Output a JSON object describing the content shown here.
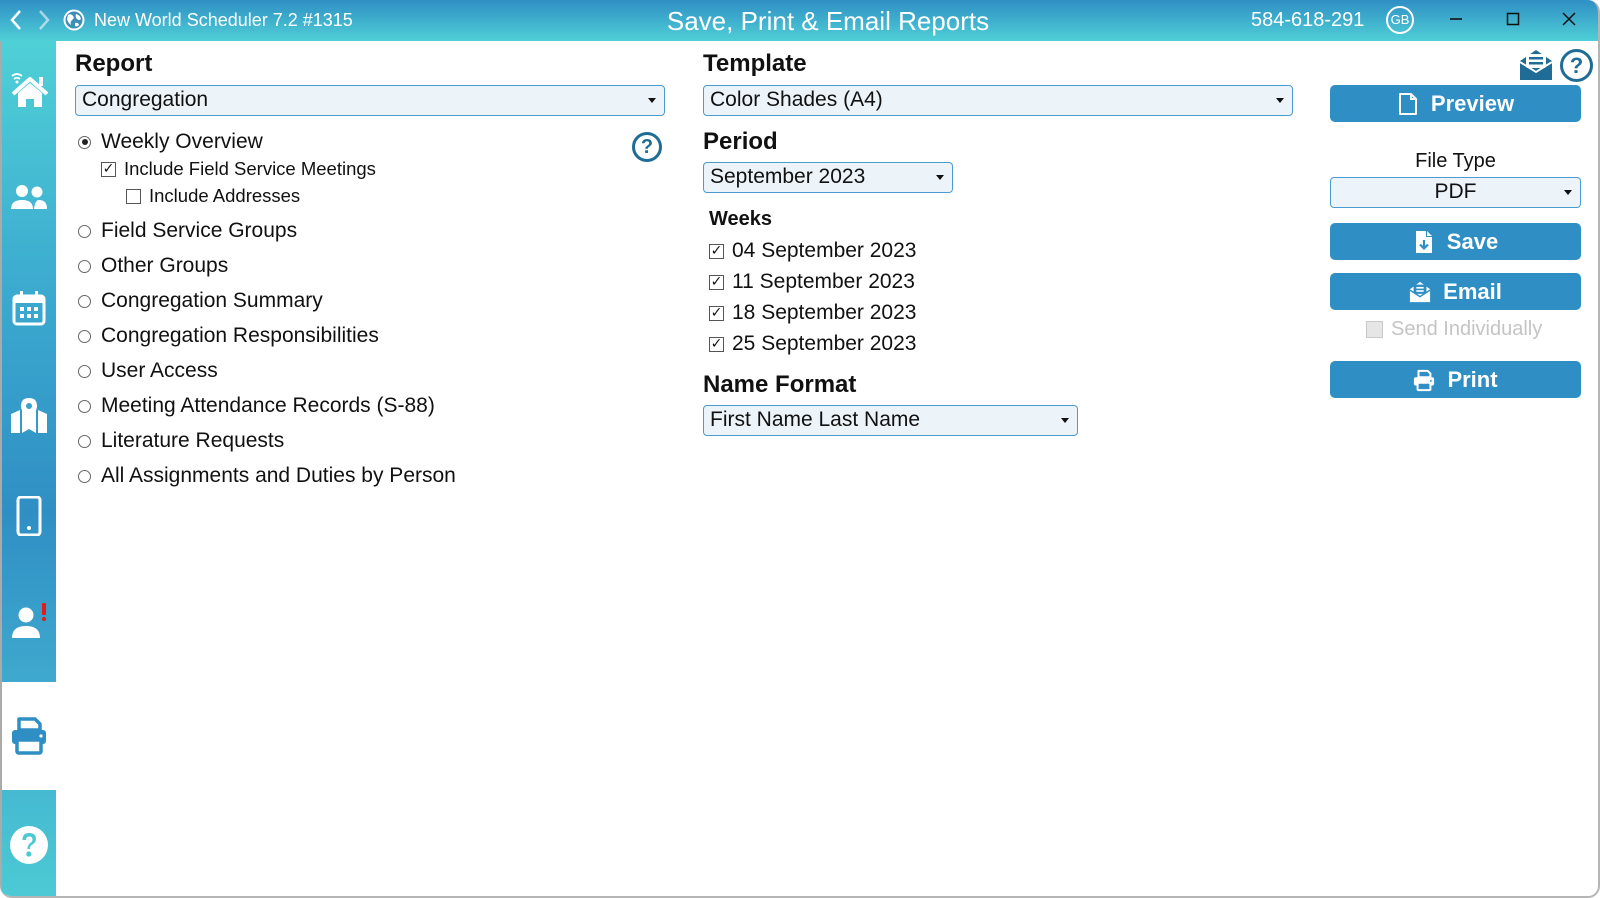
{
  "titlebar": {
    "back_icon": "chevron-left-icon",
    "forward_icon": "chevron-right-icon",
    "app_icon": "globe-icon",
    "app_name": "New World Scheduler 7.2 #1315",
    "page_title": "Save, Print & Email Reports",
    "account_id": "584-618-291",
    "language_badge": "GB",
    "minimize": "−",
    "maximize": "☐",
    "close": "✕"
  },
  "sidebar": {
    "items": [
      {
        "name": "home",
        "icon": "home-wifi-icon"
      },
      {
        "name": "people",
        "icon": "people-icon"
      },
      {
        "name": "calendar",
        "icon": "calendar-icon"
      },
      {
        "name": "territory-map",
        "icon": "map-icon"
      },
      {
        "name": "mobile",
        "icon": "phone-icon"
      },
      {
        "name": "user-alert",
        "icon": "user-alert-icon"
      },
      {
        "name": "print-reports",
        "icon": "printer-icon",
        "selected": true
      },
      {
        "name": "help",
        "icon": "help-icon"
      }
    ]
  },
  "report": {
    "label": "Report",
    "selected": "Congregation",
    "options": [
      {
        "label": "Weekly Overview",
        "checked": true,
        "sub": [
          {
            "label": "Include Field Service Meetings",
            "checked": true
          },
          {
            "label": "Include Addresses",
            "checked": false
          }
        ]
      },
      {
        "label": "Field Service Groups",
        "checked": false
      },
      {
        "label": "Other Groups",
        "checked": false
      },
      {
        "label": "Congregation Summary",
        "checked": false
      },
      {
        "label": "Congregation Responsibilities",
        "checked": false
      },
      {
        "label": "User Access",
        "checked": false
      },
      {
        "label": "Meeting Attendance Records (S-88)",
        "checked": false
      },
      {
        "label": "Literature Requests",
        "checked": false
      },
      {
        "label": "All Assignments and Duties by Person",
        "checked": false
      }
    ],
    "help": "?"
  },
  "template": {
    "label": "Template",
    "selected": "Color Shades (A4)"
  },
  "period": {
    "label": "Period",
    "selected": "September 2023",
    "weeks_label": "Weeks",
    "weeks": [
      {
        "label": "04 September 2023",
        "checked": true
      },
      {
        "label": "11 September 2023",
        "checked": true
      },
      {
        "label": "18 September 2023",
        "checked": true
      },
      {
        "label": "25 September 2023",
        "checked": true
      }
    ]
  },
  "name_format": {
    "label": "Name Format",
    "selected": "First Name Last Name"
  },
  "actions": {
    "top_help": "?",
    "preview": "Preview",
    "file_type_label": "File Type",
    "file_type": "PDF",
    "save": "Save",
    "email": "Email",
    "send_individually": "Send Individually",
    "send_individually_checked": false,
    "send_individually_enabled": false,
    "print": "Print"
  },
  "colors": {
    "accent": "#2f8fc4",
    "accent_dark": "#1f6d96",
    "titlebar_top": "#2f8fc4",
    "titlebar_bottom": "#4fcfd6",
    "select_bg": "#ecf3f9"
  }
}
